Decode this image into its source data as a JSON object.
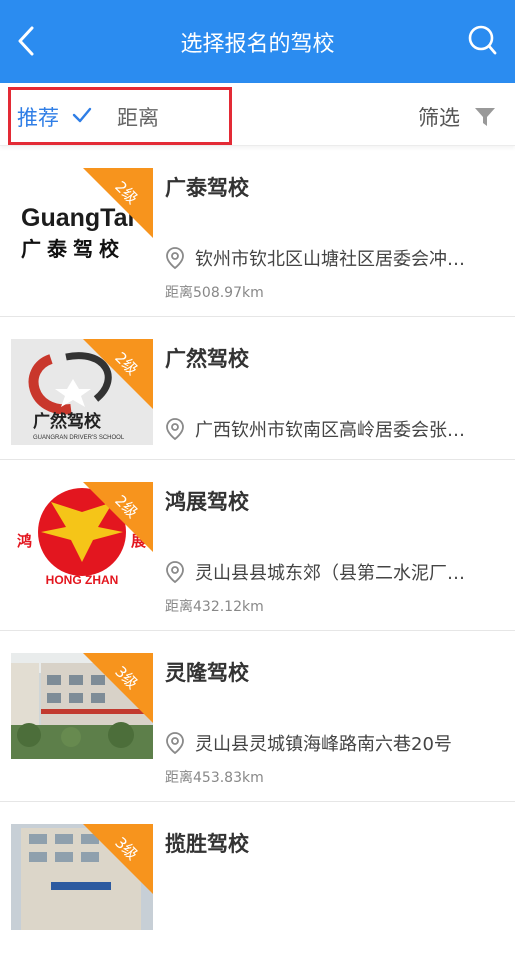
{
  "header": {
    "title": "选择报名的驾校",
    "back_icon": "chevron-left-icon",
    "search_icon": "search-icon"
  },
  "filter_bar": {
    "recommended_label": "推荐",
    "distance_label": "距离",
    "filter_label": "筛选",
    "active_tab": "推荐"
  },
  "colors": {
    "header_bg": "#2b8cf0",
    "active": "#2f7ee6",
    "badge": "#f7941d",
    "highlight_box": "#e32a35"
  },
  "schools": [
    {
      "name": "广泰驾校",
      "grade": "2级",
      "address": "钦州市钦北区山塘社区居委会冲…",
      "distance": "距离508.97km",
      "logo_text": "GuangTai",
      "logo_cn": "广泰驾校"
    },
    {
      "name": "广然驾校",
      "grade": "2级",
      "address": "广西钦州市钦南区高岭居委会张…",
      "distance": "",
      "logo_cn": "广然驾校",
      "logo_en": "GUANGRAN DRIVER'S SCHOOL"
    },
    {
      "name": "鸿展驾校",
      "grade": "2级",
      "address": "灵山县县城东郊（县第二水泥厂…",
      "distance": "距离432.12km",
      "logo_left": "鸿",
      "logo_right": "展",
      "logo_en": "HONG ZHAN"
    },
    {
      "name": "灵隆驾校",
      "grade": "3级",
      "address": "灵山县灵城镇海峰路南六巷20号",
      "distance": "距离453.83km"
    },
    {
      "name": "揽胜驾校",
      "grade": "3级",
      "address": "",
      "distance": ""
    }
  ]
}
